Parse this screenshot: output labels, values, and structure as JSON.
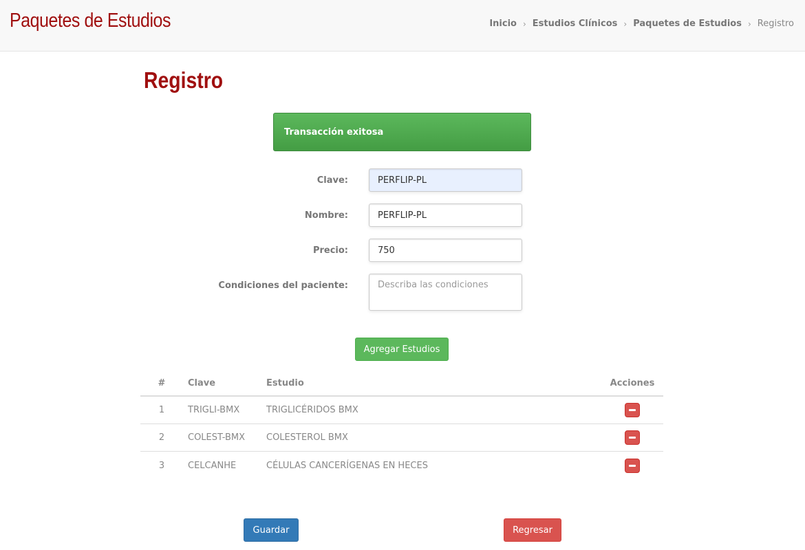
{
  "header": {
    "app_title": "Paquetes de Estudios",
    "breadcrumb": [
      {
        "label": "Inicio"
      },
      {
        "label": "Estudios Clínicos"
      },
      {
        "label": "Paquetes de Estudios"
      },
      {
        "label": "Registro"
      }
    ],
    "separator": "›"
  },
  "page_title": "Registro",
  "alert": {
    "message": "Transacción exitosa",
    "color": "#5cb85c"
  },
  "form": {
    "clave": {
      "label": "Clave:",
      "value": "PERFLIP-PL"
    },
    "nombre": {
      "label": "Nombre:",
      "value": "PERFLIP-PL"
    },
    "precio": {
      "label": "Precio:",
      "value": "750"
    },
    "condiciones": {
      "label": "Condiciones del paciente:",
      "placeholder": "Describa las condiciones",
      "value": ""
    }
  },
  "buttons": {
    "agregar": "Agregar Estudios",
    "guardar": "Guardar",
    "regresar": "Regresar"
  },
  "table": {
    "headers": {
      "num": "#",
      "clave": "Clave",
      "estudio": "Estudio",
      "acciones": "Acciones"
    },
    "rows": [
      {
        "num": "1",
        "clave": "TRIGLI-BMX",
        "estudio": "TRIGLICÉRIDOS BMX",
        "action_icon": "minus-icon"
      },
      {
        "num": "2",
        "clave": "COLEST-BMX",
        "estudio": "COLESTEROL BMX",
        "action_icon": "minus-icon"
      },
      {
        "num": "3",
        "clave": "CELCANHE",
        "estudio": "CÉLULAS CANCERÍGENAS EN HECES",
        "action_icon": "minus-icon"
      }
    ]
  },
  "colors": {
    "brand_red": "#a01010",
    "success": "#5cb85c",
    "primary": "#337ab7",
    "danger": "#d9534f"
  }
}
